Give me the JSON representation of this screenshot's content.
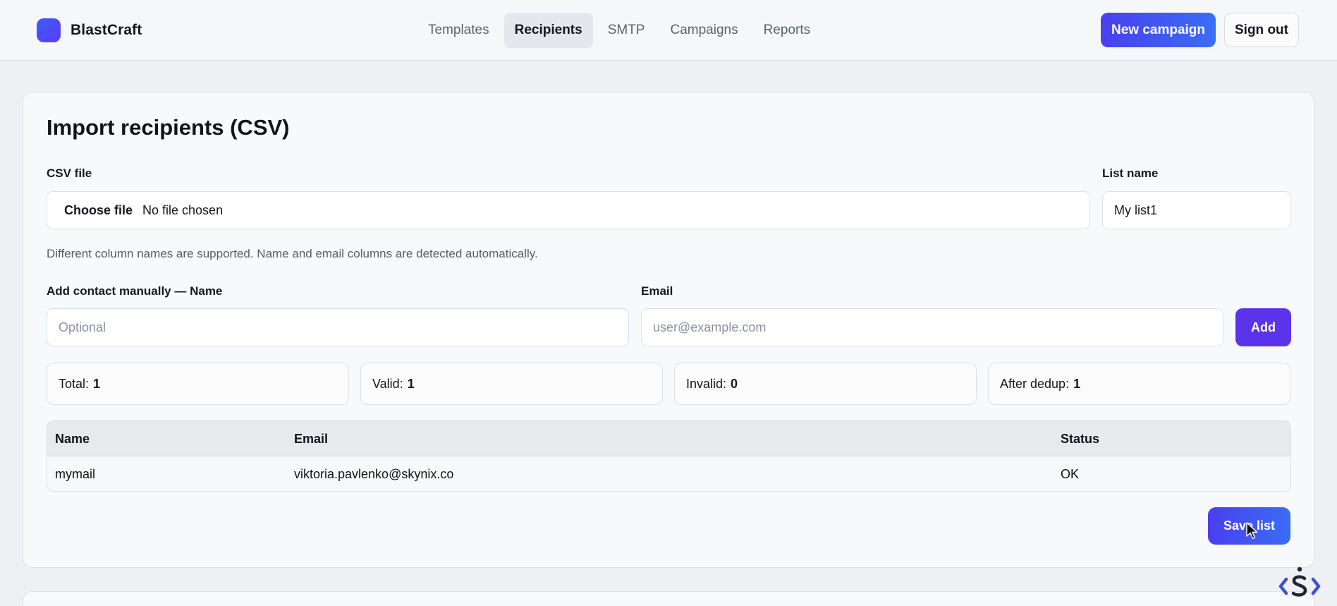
{
  "brand": {
    "name": "BlastCraft"
  },
  "nav": {
    "items": [
      {
        "label": "Templates",
        "active": false
      },
      {
        "label": "Recipients",
        "active": true
      },
      {
        "label": "SMTP",
        "active": false
      },
      {
        "label": "Campaigns",
        "active": false
      },
      {
        "label": "Reports",
        "active": false
      }
    ]
  },
  "header": {
    "new_campaign_label": "New campaign",
    "sign_out_label": "Sign out"
  },
  "import": {
    "title": "Import recipients (CSV)",
    "csv_label": "CSV file",
    "choose_file_label": "Choose file",
    "file_status": "No file chosen",
    "list_name_label": "List name",
    "list_name_value": "My list1",
    "hint": "Different column names are supported. Name and email columns are detected automatically."
  },
  "manual": {
    "name_label": "Add contact manually — Name",
    "name_placeholder": "Optional",
    "email_label": "Email",
    "email_placeholder": "user@example.com",
    "add_label": "Add"
  },
  "stats": [
    {
      "label": "Total:",
      "value": "1"
    },
    {
      "label": "Valid:",
      "value": "1"
    },
    {
      "label": "Invalid:",
      "value": "0"
    },
    {
      "label": "After dedup:",
      "value": "1"
    }
  ],
  "table": {
    "headers": [
      "Name",
      "Email",
      "Status"
    ],
    "rows": [
      [
        "mymail",
        "viktoria.pavlenko@skynix.co",
        "OK"
      ]
    ]
  },
  "save_label": "Save list",
  "colors": {
    "accent": "#4a3ff0",
    "accent_end": "#3a6df5",
    "add_button": "#5b33ea",
    "watermark": "#3b4fd8"
  },
  "icons": {
    "brand": "brand-logo-icon",
    "cursor": "mouse-pointer-icon",
    "watermark": "skynix-logo-icon"
  }
}
